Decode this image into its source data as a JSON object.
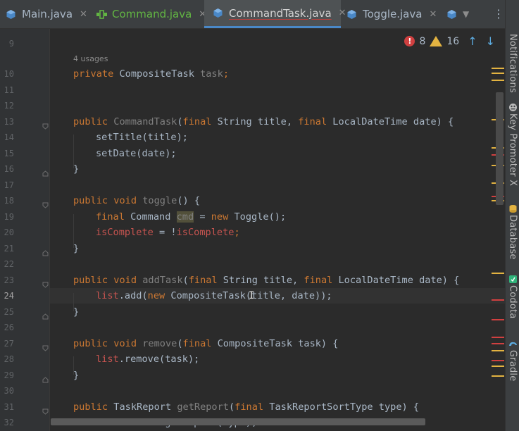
{
  "tabs": [
    {
      "label": "Main.java",
      "icon": "java-class-icon",
      "color": "#a9b7c6"
    },
    {
      "label": "Command.java",
      "icon": "interface-icon",
      "color": "#62b543"
    },
    {
      "label": "CommandTask.java",
      "icon": "java-class-icon",
      "color": "#d4d4d4",
      "active": true
    },
    {
      "label": "Toggle.java",
      "icon": "java-class-icon",
      "color": "#a9b7c6"
    }
  ],
  "tab_close": "✕",
  "tab_more": "⋮",
  "inspection": {
    "errors": "8",
    "warnings": "16",
    "error_symbol": "!",
    "up": "↑",
    "down": "↓"
  },
  "right_tools": [
    "Notifications",
    "Key Promoter X",
    "Database",
    "Codota",
    "Gradle"
  ],
  "hint_usages": "4 usages",
  "line_numbers": [
    "9",
    "10",
    "11",
    "12",
    "13",
    "14",
    "15",
    "16",
    "17",
    "18",
    "19",
    "20",
    "21",
    "22",
    "23",
    "24",
    "25",
    "26",
    "27",
    "28",
    "29",
    "30",
    "31",
    "32"
  ],
  "current_line": "24",
  "code": {
    "l10": [
      "private",
      " CompositeTask ",
      "task",
      ";"
    ],
    "l13": [
      "public",
      " ",
      "CommandTask",
      "(",
      "final",
      " String title, ",
      "final",
      " LocalDateTime date) {"
    ],
    "l14": [
      "setTitle(title);"
    ],
    "l15": [
      "setDate(date);"
    ],
    "l16": [
      "}"
    ],
    "l18": [
      "public void",
      " ",
      "toggle",
      "() {"
    ],
    "l19": [
      "final",
      " Command ",
      "cmd",
      " = ",
      "new",
      " Toggle();"
    ],
    "l20": [
      "isComplete",
      " = !",
      "isComplete",
      ";"
    ],
    "l21": [
      "}"
    ],
    "l23": [
      "public void",
      " ",
      "addTask",
      "(",
      "final",
      " String title, ",
      "final",
      " LocalDateTime date) {"
    ],
    "l24": [
      "list",
      ".add(",
      "new",
      " CompositeTask(",
      "title",
      ", date));"
    ],
    "l25": [
      "}"
    ],
    "l27": [
      "public void",
      " ",
      "remove",
      "(",
      "final",
      " CompositeTask task) {"
    ],
    "l28": [
      "list",
      ".remove(task);"
    ],
    "l29": [
      "}"
    ],
    "l31": [
      "public",
      " TaskReport ",
      "getReport",
      "(",
      "final",
      " TaskReportSortType type) {"
    ],
    "l32": [
      "return",
      " ",
      "task",
      ".getReport(type);"
    ]
  },
  "colors": {
    "keyword": "#cc7832",
    "method": "#ffc66d",
    "field": "#c75450",
    "unused": "#808080",
    "text": "#a9b7c6",
    "error": "#d04040",
    "warning": "#e3b341"
  }
}
